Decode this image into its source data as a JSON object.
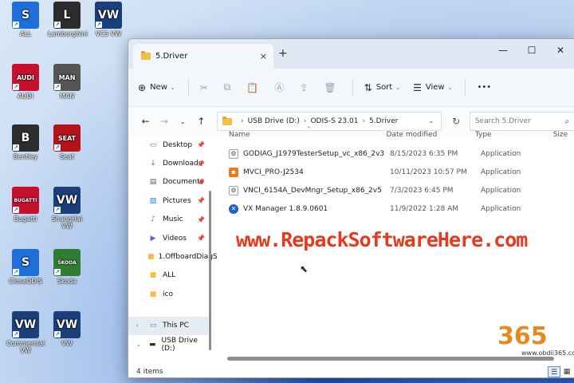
{
  "desktop": {
    "icons": [
      {
        "label": "ALL",
        "glyph": "S",
        "color": "#1e6fd9"
      },
      {
        "label": "Lamborghini",
        "glyph": "L",
        "color": "#2c2c2c"
      },
      {
        "label": "VCS VW",
        "glyph": "VW",
        "color": "#1a3f7a"
      },
      {
        "label": "AUDI",
        "glyph": "AUDI",
        "color": "#c8102e"
      },
      {
        "label": "MAN",
        "glyph": "MAN",
        "color": "#555555"
      },
      {
        "label": "Bentley",
        "glyph": "B",
        "color": "#2d2d2d"
      },
      {
        "label": "Seat",
        "glyph": "SEAT",
        "color": "#b5121b"
      },
      {
        "label": "Bugatti",
        "glyph": "BUGATTI",
        "color": "#c8102e"
      },
      {
        "label": "ShangHai VW",
        "glyph": "VW",
        "color": "#1a3f7a"
      },
      {
        "label": "CloseODIS",
        "glyph": "S",
        "color": "#1e6fd9"
      },
      {
        "label": "Skoda",
        "glyph": "ŠKODA",
        "color": "#2e7d32"
      },
      {
        "label": "Commercial VW",
        "glyph": "VW",
        "color": "#1a3f7a"
      },
      {
        "label": "VW",
        "glyph": "VW",
        "color": "#1a3f7a"
      }
    ]
  },
  "window": {
    "tab_title": "5.Driver",
    "tab_close": "×",
    "new_tab": "+",
    "controls": {
      "minimize": "—",
      "maximize": "☐",
      "close": "✕"
    }
  },
  "toolbar": {
    "new_label": "New",
    "sort_label": "Sort",
    "view_label": "View",
    "more_label": "•••"
  },
  "address": {
    "segments": [
      "USB Drive (D:)",
      "ODIS-S 23.01",
      "5.Driver"
    ],
    "search_placeholder": "Search 5.Driver"
  },
  "sidebar": {
    "items": [
      {
        "label": "Desktop",
        "icon": "desktop-icon",
        "glyph": "▭",
        "color": "#2f7fd8",
        "pinned": true
      },
      {
        "label": "Downloads",
        "icon": "download-icon",
        "glyph": "↓",
        "color": "#2f7fd8",
        "pinned": true
      },
      {
        "label": "Documents",
        "icon": "documents-icon",
        "glyph": "▤",
        "color": "#55606e",
        "pinned": true
      },
      {
        "label": "Pictures",
        "icon": "pictures-icon",
        "glyph": "▨",
        "color": "#2f7fd8",
        "pinned": true
      },
      {
        "label": "Music",
        "icon": "music-icon",
        "glyph": "♪",
        "color": "#d9534f",
        "pinned": true
      },
      {
        "label": "Videos",
        "icon": "videos-icon",
        "glyph": "▶",
        "color": "#7b4fd1",
        "pinned": true
      },
      {
        "label": "1.OffboardDiagS",
        "icon": "folder-icon",
        "glyph": "■",
        "color": "#f2c04a",
        "pinned": false
      },
      {
        "label": "ALL",
        "icon": "folder-icon",
        "glyph": "■",
        "color": "#f2c04a",
        "pinned": false
      },
      {
        "label": "ico",
        "icon": "folder-icon",
        "glyph": "■",
        "color": "#f2c04a",
        "pinned": false
      }
    ],
    "this_pc": "This PC",
    "usb_drive": "USB Drive (D:)"
  },
  "columns": {
    "name": "Name",
    "date": "Date modified",
    "type": "Type",
    "size": "Size"
  },
  "files": [
    {
      "name": "GODIAG_J1979TesterSetup_vc_x86_2v3",
      "date": "8/15/2023 6:35 PM",
      "type": "Application",
      "icon": "setup-icon"
    },
    {
      "name": "MVCI_PRO-J2534",
      "date": "10/11/2023 10:57 PM",
      "type": "Application",
      "icon": "app-icon"
    },
    {
      "name": "VNCI_6154A_DevMngr_Setup_x86_2v5",
      "date": "7/3/2023 6:45 PM",
      "type": "Application",
      "icon": "setup-icon"
    },
    {
      "name": "VX Manager 1.8.9.0601",
      "date": "11/9/2022 1:28 AM",
      "type": "Application",
      "icon": "vx-icon"
    }
  ],
  "status": {
    "item_count": "4 items"
  },
  "overlay": {
    "watermark": "www.RepackSoftwareHere.com",
    "logo_number": "365",
    "logo_site": "www.obdii365.com"
  }
}
